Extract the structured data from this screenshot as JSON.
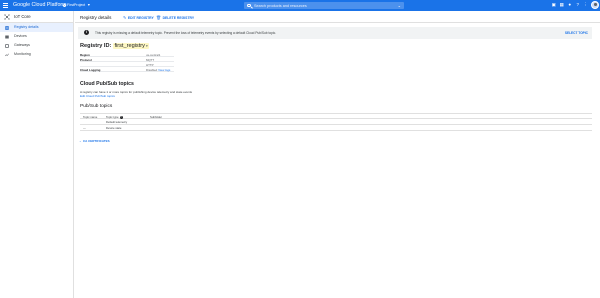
{
  "topbar": {
    "brand": "Google Cloud Platform",
    "project": "FirstProject",
    "search_placeholder": "Search products and resources",
    "accent": "#1a73e8"
  },
  "sidebar": {
    "product_title": "IoT Core",
    "items": [
      {
        "label": "Registry details",
        "icon": "registry-icon",
        "active": true
      },
      {
        "label": "Devices",
        "icon": "devices-icon",
        "active": false
      },
      {
        "label": "Gateways",
        "icon": "gateways-icon",
        "active": false
      },
      {
        "label": "Monitoring",
        "icon": "monitoring-icon",
        "active": false
      }
    ]
  },
  "header": {
    "title": "Registry details",
    "edit_label": "EDIT REGISTRY",
    "delete_label": "DELETE REGISTRY"
  },
  "banner": {
    "text": "This registry is missing a default telemetry topic. Prevent the loss of telemetry events by selecting a default Cloud Pub/Sub topic.",
    "link": "SELECT TOPIC"
  },
  "registry": {
    "id_label": "Registry ID:",
    "id_value": "first_registry"
  },
  "details": [
    {
      "key": "Region",
      "value": "us-central1"
    },
    {
      "key": "Protocol",
      "value": "MQTT"
    },
    {
      "key": "",
      "value": "HTTP"
    },
    {
      "key": "Cloud Logging",
      "value": "Disabled",
      "link": "View logs"
    }
  ],
  "pubsub": {
    "title": "Cloud Pub/Sub topics",
    "description": "A registry can have 1 or more topics for publishing device telemetry and state events",
    "edit_link": "Edit Cloud Pub/Sub topics",
    "topics_title": "Pub/Sub topics",
    "columns": [
      "Topic name",
      "Topic type",
      "Subfolder"
    ],
    "rows": [
      [
        "",
        "Default telemetry",
        ""
      ],
      [
        "—",
        "Device state",
        ""
      ]
    ]
  },
  "certs_label": "CA CERTIFICATES"
}
